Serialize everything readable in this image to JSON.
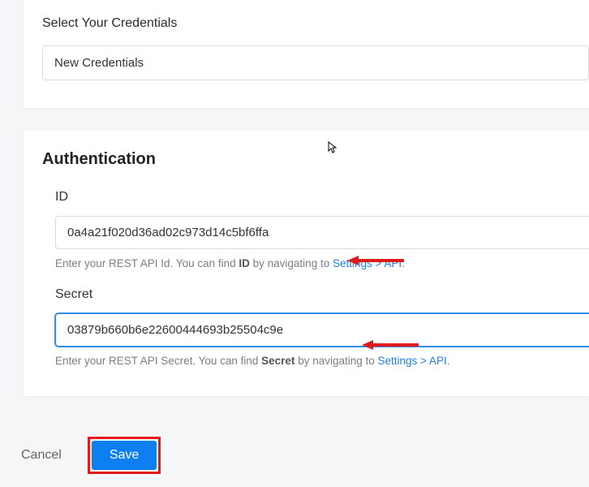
{
  "credentials": {
    "label": "Select Your Credentials",
    "selected": "New Credentials"
  },
  "authentication": {
    "heading": "Authentication",
    "id": {
      "label": "ID",
      "value": "0a4a21f020d36ad02c973d14c5bf6ffa",
      "hint_prefix": "Enter your REST API Id. You can find ",
      "hint_strong": "ID",
      "hint_mid": " by navigating to ",
      "hint_link": "Settings > API",
      "hint_suffix": "."
    },
    "secret": {
      "label": "Secret",
      "value": "03879b660b6e22600444693b25504c9e",
      "hint_prefix": "Enter your REST API Secret. You can find ",
      "hint_strong": "Secret",
      "hint_mid": " by navigating to ",
      "hint_link": "Settings > API",
      "hint_suffix": "."
    }
  },
  "footer": {
    "cancel": "Cancel",
    "save": "Save"
  },
  "colors": {
    "link": "#1e7fe6",
    "primary_button": "#0d7ff0",
    "annotation_red": "#e11b1b"
  }
}
